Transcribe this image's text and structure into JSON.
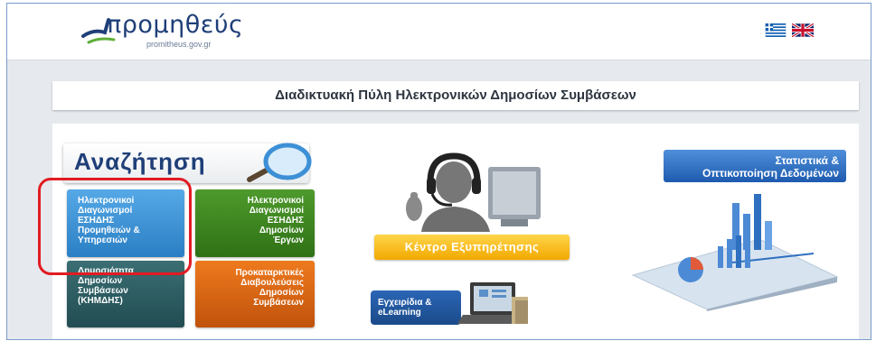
{
  "header": {
    "logo_text": "προμηθεύς",
    "logo_subtext": "promitheus.gov.gr",
    "languages": [
      "greek-flag",
      "uk-flag"
    ]
  },
  "title": "Διαδικτυακή Πύλη Ηλεκτρονικών Δημοσίων Συμβάσεων",
  "search": {
    "label": "Αναζήτηση",
    "tiles": [
      {
        "lines": [
          "Ηλεκτρονικοί",
          "Διαγωνισμοί",
          "ΕΣΗΔΗΣ",
          "Προμηθειών &",
          "Υπηρεσιών"
        ]
      },
      {
        "lines": [
          "Ηλεκτρονικοί",
          "Διαγωνισμοί",
          "ΕΣΗΔΗΣ",
          "Δημοσίων",
          "Έργων"
        ]
      },
      {
        "lines": [
          "Δημοσιότητα",
          "Δημοσίων",
          "Συμβάσεων",
          "(ΚΗΜΔΗΣ)"
        ]
      },
      {
        "lines": [
          "Προκαταρκτικές",
          "Διαβουλεύσεις",
          "Δημοσίων",
          "Συμβάσεων"
        ]
      }
    ]
  },
  "support": {
    "label": "Κέντρο Εξυπηρέτησης"
  },
  "manuals": {
    "lines": [
      "Εγχειρίδια &",
      "eLearning"
    ]
  },
  "stats": {
    "lines": [
      "Στατιστικά &",
      "Οπτικοποίηση Δεδομένων"
    ]
  },
  "colors": {
    "brand_blue": "#1f3f78",
    "highlight_red": "#e21b22",
    "tile_blue": "#2a7fc4",
    "tile_green": "#2f7116",
    "tile_teal": "#214c52",
    "tile_orange": "#c0520b",
    "support_yellow": "#f2a900"
  }
}
